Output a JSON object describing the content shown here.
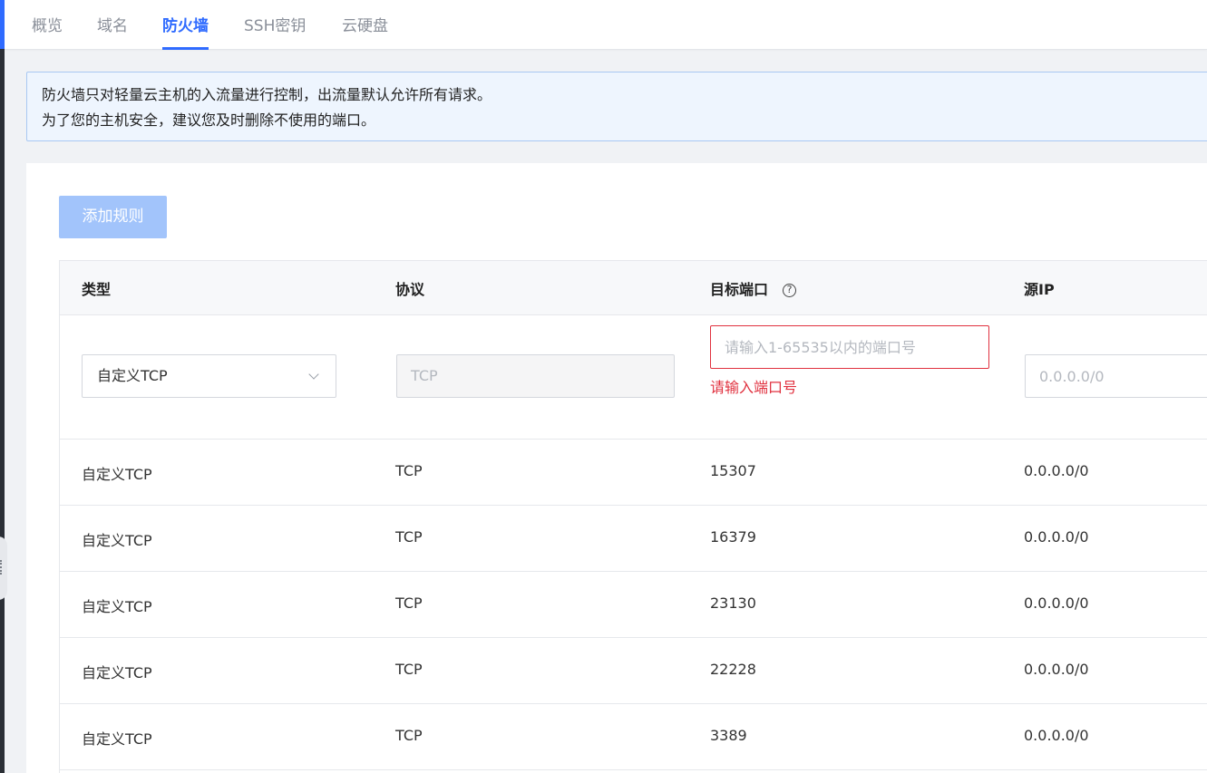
{
  "tabs": [
    {
      "label": "概览",
      "active": false
    },
    {
      "label": "域名",
      "active": false
    },
    {
      "label": "防火墙",
      "active": true
    },
    {
      "label": "SSH密钥",
      "active": false
    },
    {
      "label": "云硬盘",
      "active": false
    }
  ],
  "notice": {
    "line1": "防火墙只对轻量云主机的入流量进行控制，出流量默认允许所有请求。",
    "line2": "为了您的主机安全，建议您及时删除不使用的端口。"
  },
  "toolbar": {
    "add_rule_label": "添加规则"
  },
  "table": {
    "headers": {
      "type": "类型",
      "protocol": "协议",
      "port": "目标端口",
      "source_ip": "源IP"
    },
    "help_icon": "question-circle-icon",
    "edit_row": {
      "type_value": "自定义TCP",
      "protocol_value": "TCP",
      "port_placeholder": "请输入1-65535以内的端口号",
      "port_error": "请输入端口号",
      "ip_placeholder": "0.0.0.0/0"
    },
    "rows": [
      {
        "type": "自定义TCP",
        "protocol": "TCP",
        "port": "15307",
        "source_ip": "0.0.0.0/0"
      },
      {
        "type": "自定义TCP",
        "protocol": "TCP",
        "port": "16379",
        "source_ip": "0.0.0.0/0"
      },
      {
        "type": "自定义TCP",
        "protocol": "TCP",
        "port": "23130",
        "source_ip": "0.0.0.0/0"
      },
      {
        "type": "自定义TCP",
        "protocol": "TCP",
        "port": "22228",
        "source_ip": "0.0.0.0/0"
      },
      {
        "type": "自定义TCP",
        "protocol": "TCP",
        "port": "3389",
        "source_ip": "0.0.0.0/0"
      }
    ]
  },
  "colors": {
    "accent": "#2f6bff",
    "error": "#e0313f",
    "button_disabled": "#a2c4fb"
  }
}
